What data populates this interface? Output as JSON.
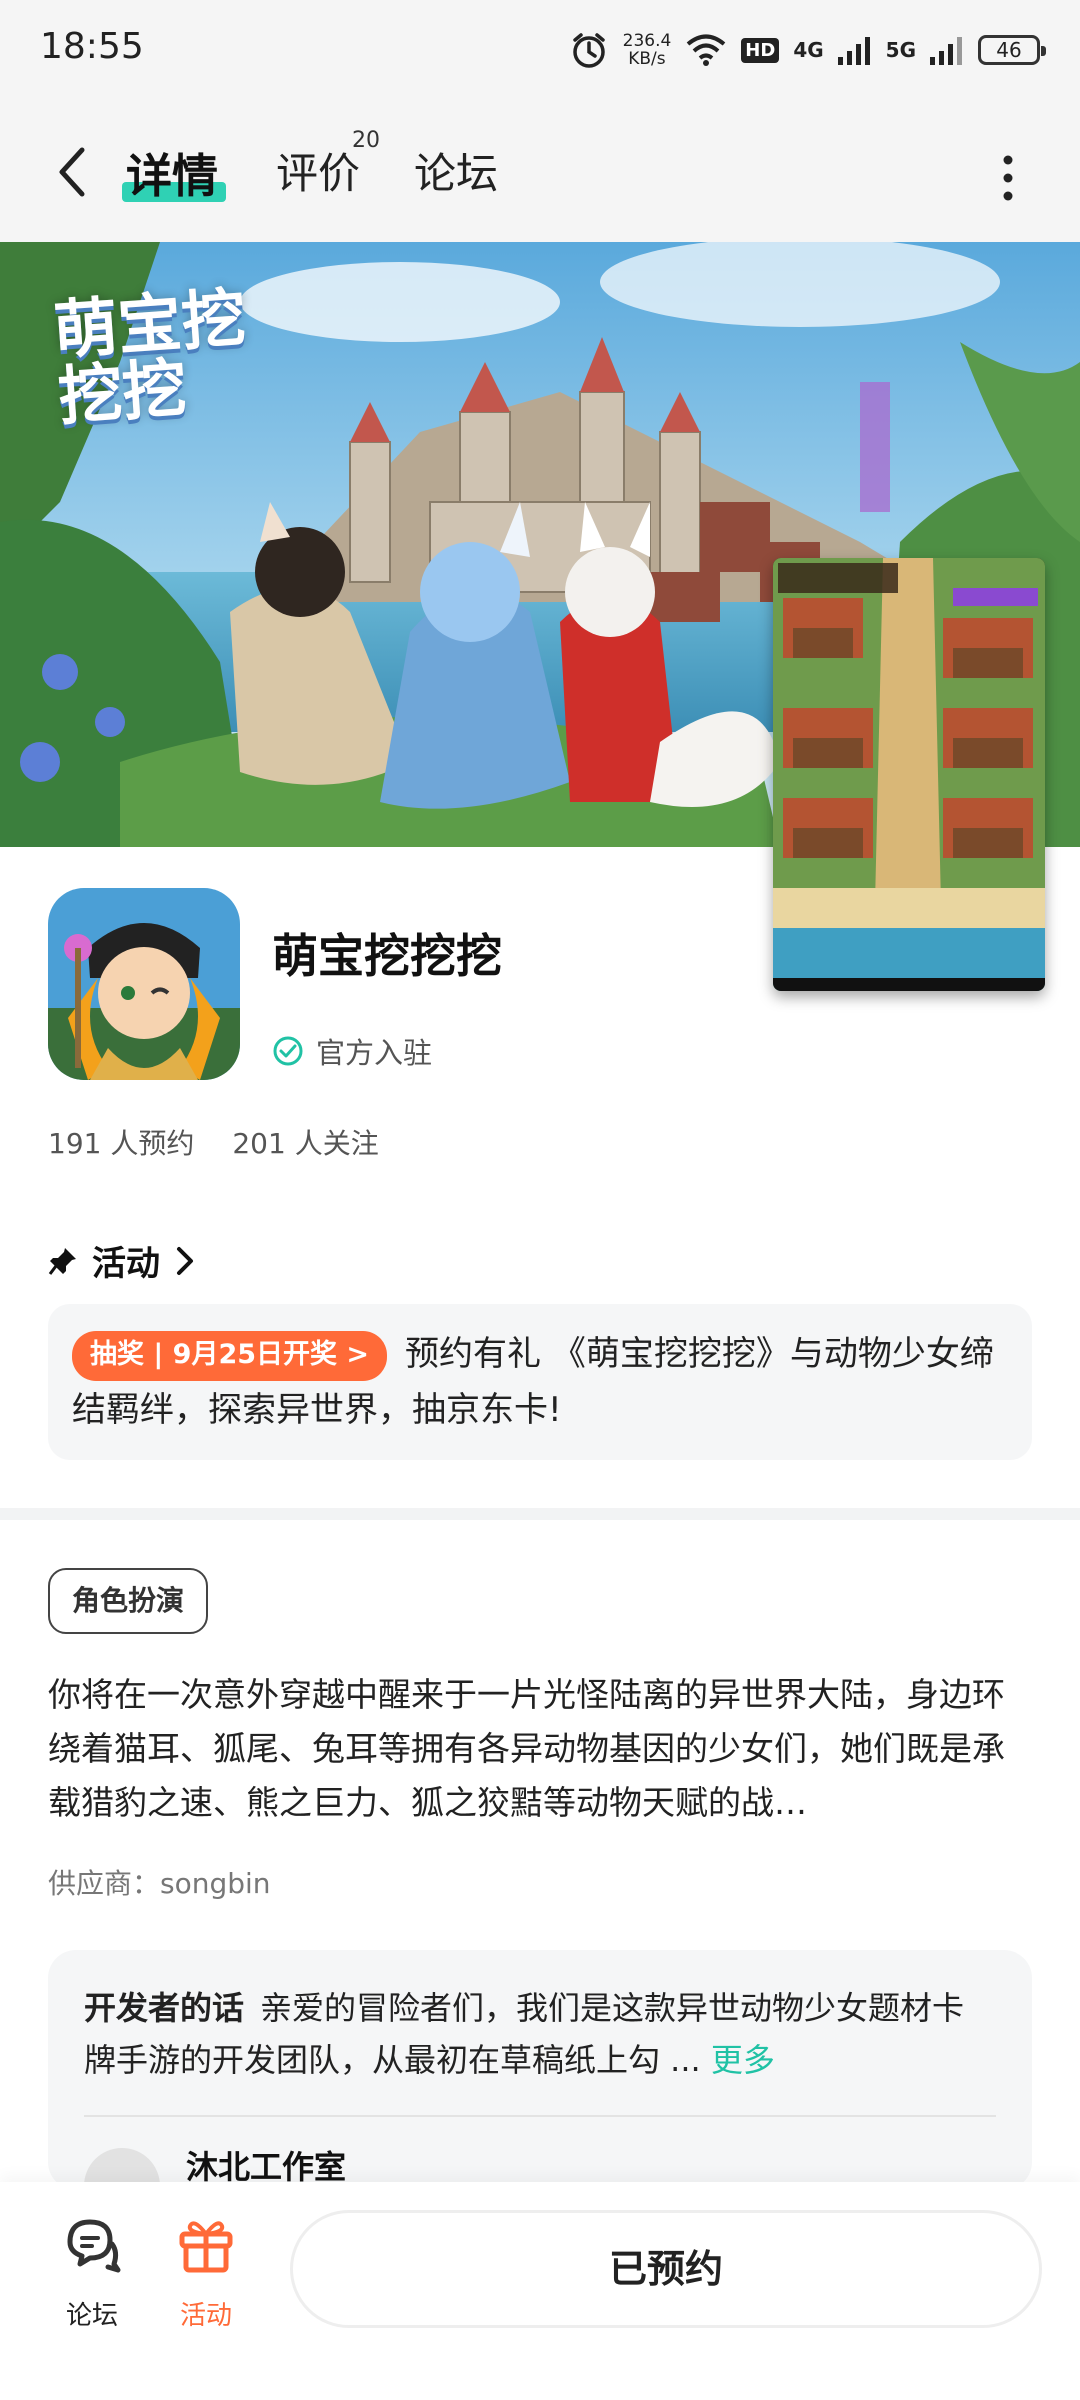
{
  "status_bar": {
    "time": "18:55",
    "net_speed": "236.4",
    "net_unit": "KB/s",
    "hd_label": "HD",
    "net1": "4G",
    "net2": "5G",
    "battery": "46"
  },
  "header": {
    "tabs": [
      {
        "label": "详情",
        "active": true
      },
      {
        "label": "评价",
        "badge": "20"
      },
      {
        "label": "论坛"
      }
    ]
  },
  "banner": {
    "logo": "萌宝挖挖挖"
  },
  "app": {
    "name": "萌宝挖挖挖",
    "official_label": "官方入驻",
    "reservations": "191 人预约",
    "followers": "201 人关注"
  },
  "activity": {
    "title": "活动",
    "tag": "抽奖 | 9月25日开奖 >",
    "text": "预约有礼 《萌宝挖挖挖》与动物少女缔结羁绊，探索异世界，抽京东卡!"
  },
  "description": {
    "genre": "角色扮演",
    "text": "你将在一次意外穿越中醒来于一片光怪陆离的异世界大陆，身边环绕着猫耳、狐尾、兔耳等拥有各异动物基因的少女们，她们既是承载猎豹之速、熊之巨力、狐之狡黠等动物天赋的战…",
    "supplier": "供应商：songbin"
  },
  "developer": {
    "label": "开发者的话",
    "text": "亲爱的冒险者们，我们是这款异世动物少女题材卡牌手游的开发团队，从最初在草稿纸上勾 ...",
    "more": "更多",
    "studio": "沐北工作室"
  },
  "bottom_bar": {
    "forum_label": "论坛",
    "activity_label": "活动",
    "reserve_button": "已预约"
  },
  "colors": {
    "accent": "#2fd1b4",
    "orange": "#ff6a38",
    "more_link": "#20c2a5"
  }
}
